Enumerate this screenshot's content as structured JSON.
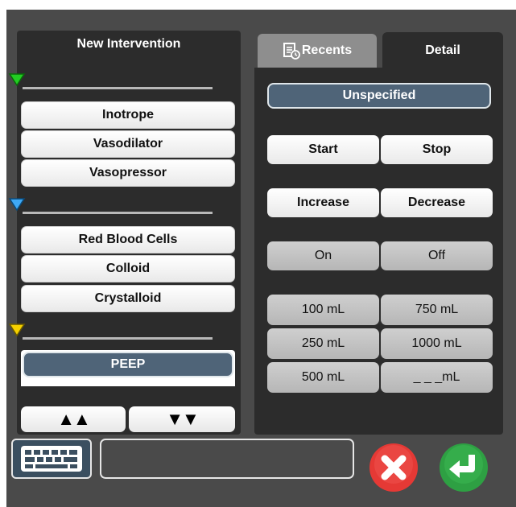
{
  "left_panel": {
    "title": "New Intervention",
    "categories": [
      {
        "color": "#22cc22",
        "items": [
          "Inotrope",
          "Vasodilator",
          "Vasopressor"
        ]
      },
      {
        "color": "#3fa9f5",
        "items": [
          "Red Blood Cells",
          "Colloid",
          "Crystalloid"
        ]
      },
      {
        "color": "#f5d000",
        "items": [
          "PEEP"
        ]
      }
    ],
    "scroll_up_label": "▲▲",
    "scroll_down_label": "▼▼"
  },
  "tabs": {
    "recents_label": "Recents",
    "detail_label": "Detail"
  },
  "detail": {
    "selected_label": "Unspecified",
    "start_label": "Start",
    "stop_label": "Stop",
    "increase_label": "Increase",
    "decrease_label": "Decrease",
    "on_label": "On",
    "off_label": "Off",
    "volumes": [
      "100 mL",
      "750 mL",
      "250 mL",
      "1000 mL",
      "500 mL",
      "_ _ _mL"
    ]
  },
  "bottom_bar": {
    "text_entry_value": "",
    "cancel_color": "#e53935",
    "confirm_color": "#2ea043"
  }
}
